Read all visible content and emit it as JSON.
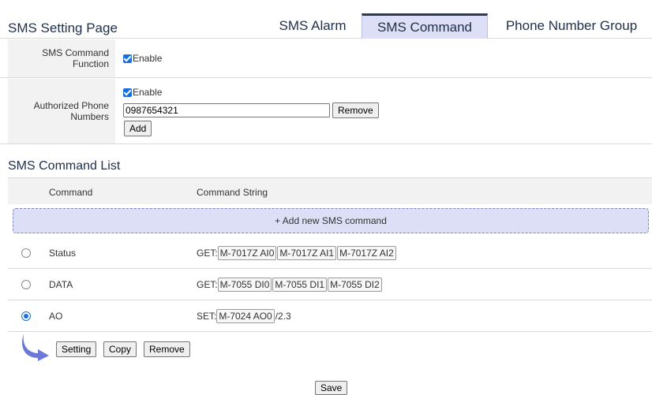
{
  "header": {
    "page_title": "SMS Setting Page",
    "tabs": [
      {
        "label": "SMS Alarm",
        "active": false
      },
      {
        "label": "SMS Command",
        "active": true
      },
      {
        "label": "Phone Number Group",
        "active": false
      }
    ]
  },
  "sms_command_function": {
    "label": "SMS Command Function",
    "enable_label": "Enable",
    "enabled": true
  },
  "authorized_phone": {
    "label": "Authorized Phone Numbers",
    "enable_label": "Enable",
    "enabled": true,
    "phone_value": "0987654321",
    "remove_label": "Remove",
    "add_label": "Add"
  },
  "command_list": {
    "title": "SMS Command List",
    "columns": [
      "Command",
      "Command String"
    ],
    "add_new_label": "+ Add new SMS command",
    "rows": [
      {
        "name": "Status",
        "selected": false,
        "prefix": "GET:",
        "parts": [
          "M-7017Z AI0",
          "M-7017Z AI1",
          "M-7017Z AI2"
        ],
        "suffix": ""
      },
      {
        "name": "DATA",
        "selected": false,
        "prefix": "GET:",
        "parts": [
          "M-7055 DI0",
          "M-7055 DI1",
          "M-7055 DI2"
        ],
        "suffix": ""
      },
      {
        "name": "AO",
        "selected": true,
        "prefix": "SET:",
        "parts": [
          "M-7024 AO0"
        ],
        "suffix": "/2.3"
      }
    ],
    "actions": {
      "setting_label": "Setting",
      "copy_label": "Copy",
      "remove_label": "Remove"
    }
  },
  "save_label": "Save",
  "colors": {
    "accent": "#1a6fdf",
    "tab_active_bg": "#dcdff5",
    "arrow": "#6b78d8"
  },
  "icons": {
    "selected_row_arrow": "curved-arrow-icon"
  }
}
